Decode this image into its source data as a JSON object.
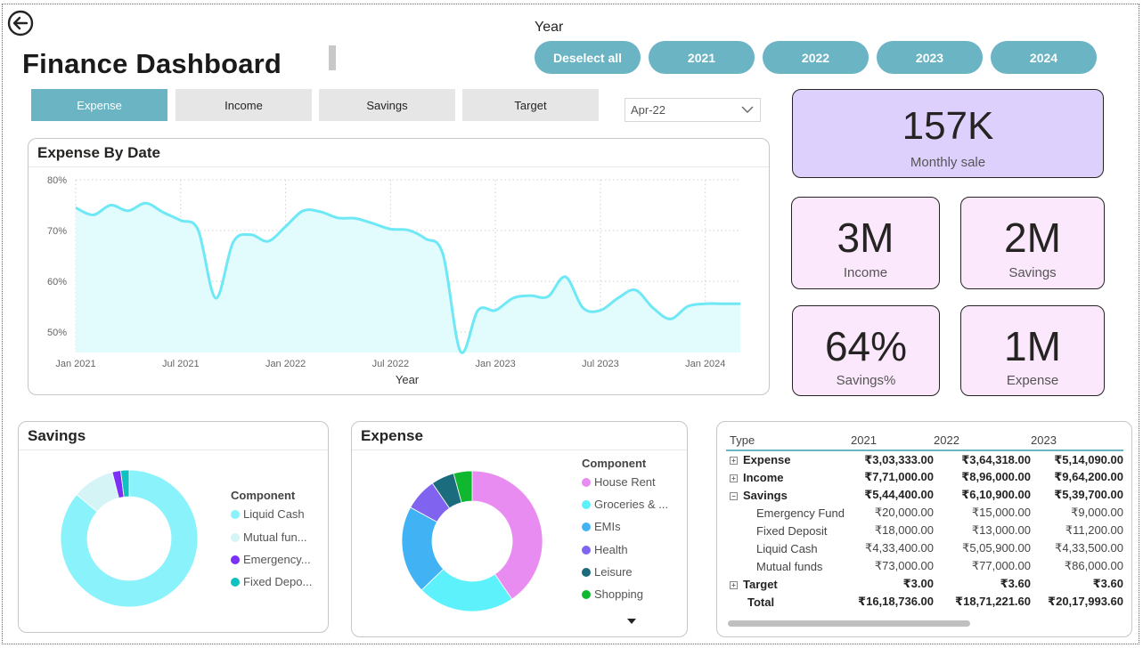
{
  "header": {
    "title": "Finance Dashboard",
    "year_label": "Year",
    "year_buttons": [
      "Deselect all",
      "2021",
      "2022",
      "2023",
      "2024"
    ]
  },
  "tabs": [
    "Expense",
    "Income",
    "Savings",
    "Target"
  ],
  "date_filter": {
    "value": "Apr-22"
  },
  "kpis": {
    "monthly_sale": {
      "value": "157K",
      "label": "Monthly sale"
    },
    "income": {
      "value": "3M",
      "label": "Income"
    },
    "savings": {
      "value": "2M",
      "label": "Savings"
    },
    "savings_pct": {
      "value": "64%",
      "label": "Savings%"
    },
    "expense": {
      "value": "1M",
      "label": "Expense"
    }
  },
  "colors": {
    "accent": "#6ab4c3",
    "line": "#6ee8f5",
    "area": "#e2fbfd",
    "kpi_purple": "#ddd0fc",
    "kpi_pink": "#fbe8fc"
  },
  "chart_data": [
    {
      "type": "area",
      "title": "Expense By Date",
      "xlabel": "Year",
      "ylabel": "",
      "x_ticks": [
        "Jan 2021",
        "Jul 2021",
        "Jan 2022",
        "Jul 2022",
        "Jan 2023",
        "Jul 2023",
        "Jan 2024"
      ],
      "y_ticks": [
        "80%",
        "70%",
        "60%",
        "50%"
      ],
      "ylim": [
        46,
        80
      ],
      "grid": true,
      "x": [
        0,
        1,
        2,
        3,
        4,
        5,
        6,
        7,
        8,
        9,
        10,
        11,
        12,
        13,
        14,
        15,
        16,
        17,
        18,
        19,
        20,
        21,
        22,
        23,
        24,
        25,
        26,
        27,
        28,
        29,
        30,
        31,
        32,
        33,
        34,
        35,
        36,
        37,
        38
      ],
      "values": [
        74.5,
        73.1,
        75.0,
        73.9,
        75.4,
        73.6,
        72.0,
        70.1,
        56.7,
        67.7,
        69.2,
        67.9,
        70.8,
        73.9,
        73.7,
        72.5,
        72.4,
        71.4,
        70.3,
        70.1,
        68.4,
        65.3,
        46.2,
        54.3,
        54.3,
        56.7,
        57.2,
        57.0,
        60.9,
        54.8,
        54.3,
        56.7,
        58.3,
        54.8,
        52.6,
        55.1,
        55.6,
        55.6,
        55.6
      ]
    },
    {
      "type": "pie",
      "title": "Savings",
      "legend_title": "Component",
      "legend_position": "right",
      "categories": [
        "Liquid Cash",
        "Mutual fun...",
        "Emergency...",
        "Fixed Depo..."
      ],
      "values": [
        13.0,
        1.5,
        0.3,
        0.3
      ],
      "colors": [
        "#8af2fb",
        "#d5f4f6",
        "#7b2ff7",
        "#10c1c2"
      ]
    },
    {
      "type": "pie",
      "title": "Expense",
      "legend_title": "Component",
      "legend_position": "right",
      "categories": [
        "House Rent",
        "Groceries & ...",
        "EMIs",
        "Health",
        "Leisure",
        "Shopping"
      ],
      "values": [
        38,
        21,
        19,
        7,
        5,
        4
      ],
      "colors": [
        "#e98cf2",
        "#5cf1fb",
        "#41b3f5",
        "#8064f0",
        "#1b6c7c",
        "#10b830"
      ]
    }
  ],
  "matrix": {
    "headers": [
      "Type",
      "2021",
      "2022",
      "2023"
    ],
    "rows": [
      {
        "label": "Expense",
        "level": 0,
        "expander": "+",
        "values": [
          "₹3,03,333.00",
          "₹3,64,318.00",
          "₹5,14,090.00"
        ]
      },
      {
        "label": "Income",
        "level": 0,
        "expander": "+",
        "values": [
          "₹7,71,000.00",
          "₹8,96,000.00",
          "₹9,64,200.00"
        ]
      },
      {
        "label": "Savings",
        "level": 0,
        "expander": "−",
        "values": [
          "₹5,44,400.00",
          "₹6,10,900.00",
          "₹5,39,700.00"
        ]
      },
      {
        "label": "Emergency Fund",
        "level": 1,
        "expander": "",
        "values": [
          "₹20,000.00",
          "₹15,000.00",
          "₹9,000.00"
        ]
      },
      {
        "label": "Fixed Deposit",
        "level": 1,
        "expander": "",
        "values": [
          "₹18,000.00",
          "₹13,000.00",
          "₹11,200.00"
        ]
      },
      {
        "label": "Liquid Cash",
        "level": 1,
        "expander": "",
        "values": [
          "₹4,33,400.00",
          "₹5,05,900.00",
          "₹4,33,500.00"
        ]
      },
      {
        "label": "Mutual funds",
        "level": 1,
        "expander": "",
        "values": [
          "₹73,000.00",
          "₹77,000.00",
          "₹86,000.00"
        ]
      },
      {
        "label": "Target",
        "level": 0,
        "expander": "+",
        "values": [
          "₹3.00",
          "₹3.60",
          "₹3.60"
        ]
      },
      {
        "label": "Total",
        "level": 0,
        "expander": "",
        "values": [
          "₹16,18,736.00",
          "₹18,71,221.60",
          "₹20,17,993.60"
        ]
      }
    ]
  }
}
